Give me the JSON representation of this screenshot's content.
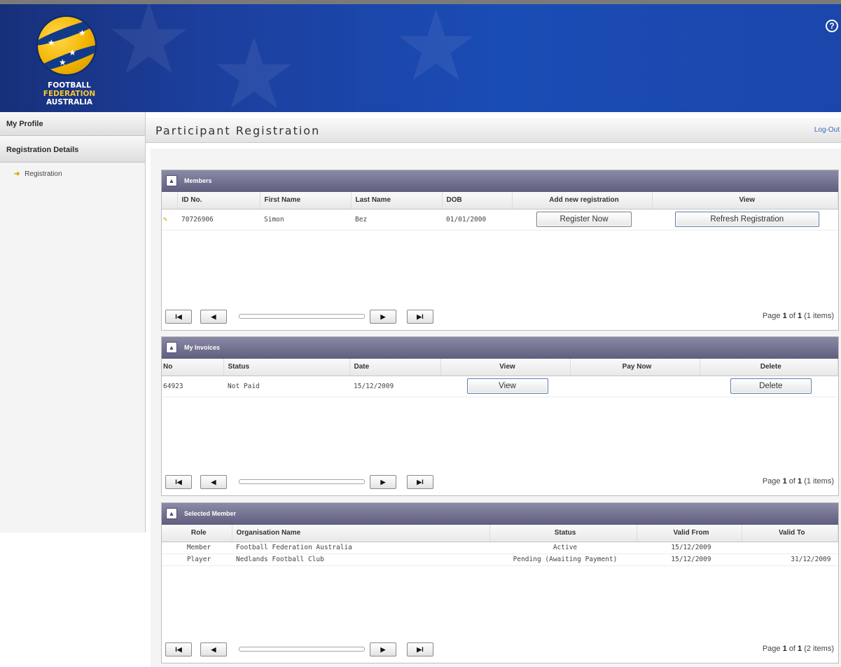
{
  "header": {
    "logo_lines": [
      "FOOTBALL",
      "FEDERATION",
      "AUSTRALIA"
    ],
    "help_icon": "help-icon"
  },
  "sidebar": {
    "sections": [
      {
        "label": "My Profile"
      },
      {
        "label": "Registration Details"
      }
    ],
    "items": [
      {
        "label": "Registration",
        "icon": "arrow-icon"
      }
    ]
  },
  "titlebar": {
    "title": "Participant Registration",
    "logout": "Log-Out"
  },
  "members": {
    "title": "Members",
    "columns": [
      "ID No.",
      "First Name",
      "Last Name",
      "DOB",
      "Add new registration",
      "View"
    ],
    "rows": [
      {
        "id": "70726906",
        "first": "Simon",
        "last": "Bez",
        "dob": "01/01/2000",
        "add_btn": "Register Now",
        "view_btn": "Refresh Registration"
      }
    ],
    "pager": {
      "text_pre": "Page",
      "page": "1",
      "text_mid": "of",
      "total": "1",
      "items": "(1 items)"
    }
  },
  "invoices": {
    "title": "My Invoices",
    "columns": [
      "No",
      "Status",
      "Date",
      "View",
      "Pay Now",
      "Delete"
    ],
    "rows": [
      {
        "no": "64923",
        "status": "Not Paid",
        "date": "15/12/2009",
        "view_btn": "View",
        "pay": "",
        "delete_btn": "Delete"
      }
    ],
    "pager": {
      "text_pre": "Page",
      "page": "1",
      "text_mid": "of",
      "total": "1",
      "items": "(1 items)"
    }
  },
  "selected": {
    "title": "Selected Member",
    "columns": [
      "Role",
      "Organisation Name",
      "Status",
      "Valid From",
      "Valid To"
    ],
    "rows": [
      {
        "role": "Member",
        "org": "Football Federation Australia",
        "status": "Active",
        "from": "15/12/2009",
        "to": ""
      },
      {
        "role": "Player",
        "org": "Nedlands Football Club",
        "status": "Pending (Awaiting Payment)",
        "from": "15/12/2009",
        "to": "31/12/2009"
      }
    ],
    "pager": {
      "text_pre": "Page",
      "page": "1",
      "text_mid": "of",
      "total": "1",
      "items": "(2 items)"
    }
  },
  "pager_buttons": {
    "first": "I◀",
    "prev": "◀",
    "next": "▶",
    "last": "▶I"
  },
  "colors": {
    "banner": "#1c3f9e",
    "panel_header": "#6f6e8e",
    "accent_yellow": "#f4b400",
    "link": "#3a6db5"
  }
}
